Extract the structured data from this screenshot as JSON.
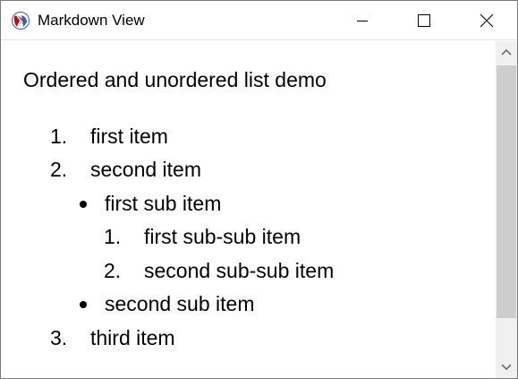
{
  "window": {
    "title": "Markdown View",
    "app_icon": "racket-logo-icon",
    "controls": [
      "minimize-icon",
      "maximize-icon",
      "close-icon"
    ]
  },
  "document": {
    "heading": "Ordered and unordered list demo",
    "list": [
      {
        "marker": "1.",
        "text": "first item"
      },
      {
        "marker": "2.",
        "text": "second item"
      },
      {
        "marker": "•",
        "text": "first sub item"
      },
      {
        "marker": "1.",
        "text": "first sub-sub item"
      },
      {
        "marker": "2.",
        "text": "second sub-sub item"
      },
      {
        "marker": "•",
        "text": "second sub item"
      },
      {
        "marker": "3.",
        "text": "third item"
      }
    ]
  },
  "scrollbar": {
    "up_icon": "chevron-up-icon",
    "down_icon": "chevron-down-icon"
  }
}
